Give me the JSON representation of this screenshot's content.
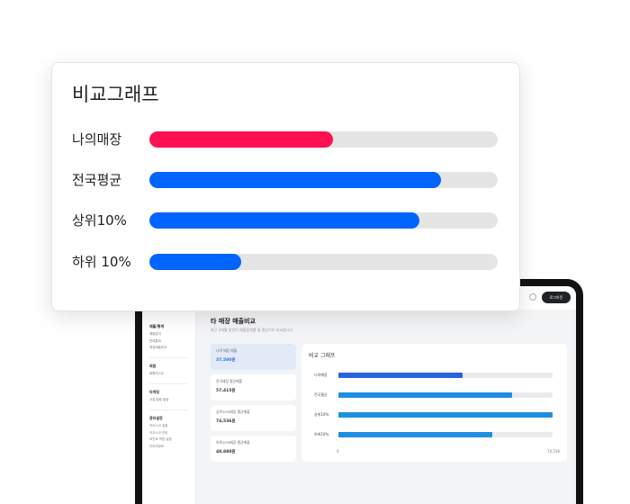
{
  "comparison_card": {
    "title": "비교그래프",
    "rows": [
      {
        "label": "나의매장",
        "fraction": 0.527,
        "color": "#ff1052"
      },
      {
        "label": "전국평균",
        "fraction": 0.837,
        "color": "#0064ff"
      },
      {
        "label": "상위10%",
        "fraction": 0.775,
        "color": "#0064ff"
      },
      {
        "label": "하위 10%",
        "fraction": 0.264,
        "color": "#0064ff"
      }
    ]
  },
  "device": {
    "topbar": {
      "settings_icon": "gear-icon",
      "action_label": "로그아웃"
    },
    "sidebar": {
      "groups": [
        {
          "heading": "매출/통계",
          "items": [
            "매출분석",
            "판매통계",
            "매장매출비교"
          ]
        },
        {
          "heading": "회원",
          "items": [
            "회원리스트"
          ]
        },
        {
          "heading": "마케팅",
          "items": [
            "쿠폰/알림 발송"
          ]
        },
        {
          "heading": "관리설정",
          "items": [
            "키오스크 설정",
            "키오스크 관리",
            "포인트 적립 설정",
            "관리자정보"
          ]
        }
      ]
    },
    "main": {
      "title": "타 매장 매출비교",
      "subtitle": "최근 3개월 동안의 매출합계를 월 평균으로 비교합니다.",
      "cards": [
        {
          "label": "나의 매장 매출",
          "value": "37,500원"
        },
        {
          "label": "전국매장 평균매출",
          "value": "57,415원"
        },
        {
          "label": "상위10%매장 평균매출",
          "value": "74,536원"
        },
        {
          "label": "하위10%매장 평균매출",
          "value": "48,880원"
        }
      ],
      "chart": {
        "title": "비교 그래프",
        "axis_min": "0",
        "axis_max": "74,536",
        "rows": [
          {
            "label": "나의매장",
            "fraction": 0.58,
            "color": "#2a63e0"
          },
          {
            "label": "전국평균",
            "fraction": 0.81,
            "color": "#1e8fe0"
          },
          {
            "label": "상위10%",
            "fraction": 1.0,
            "color": "#1e8fe0"
          },
          {
            "label": "하위10%",
            "fraction": 0.72,
            "color": "#1e8fe0"
          }
        ]
      }
    }
  }
}
